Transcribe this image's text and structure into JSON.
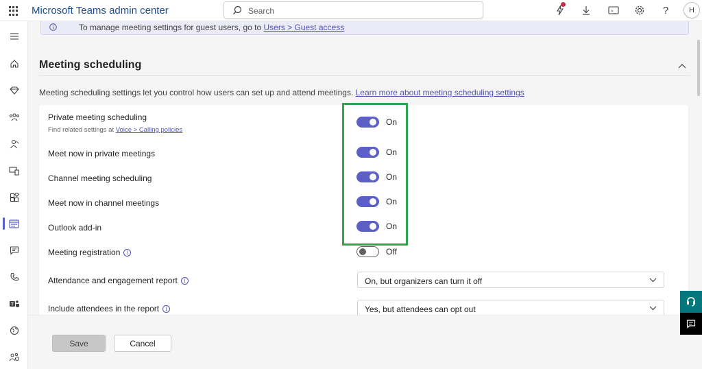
{
  "app": {
    "title": "Microsoft Teams admin center"
  },
  "search": {
    "placeholder": "Search"
  },
  "user": {
    "initial": "H"
  },
  "banner": {
    "text": "To manage meeting settings for guest users, go to ",
    "link": "Users > Guest access"
  },
  "section": {
    "title": "Meeting scheduling",
    "description": "Meeting scheduling settings let you control how users can set up and attend meetings. ",
    "learn_more": "Learn more about meeting scheduling settings"
  },
  "settings": [
    {
      "label": "Private meeting scheduling",
      "sub_prefix": "Find related settings at ",
      "sub_link": "Voice > Calling policies",
      "state": "On",
      "on": true
    },
    {
      "label": "Meet now in private meetings",
      "state": "On",
      "on": true
    },
    {
      "label": "Channel meeting scheduling",
      "state": "On",
      "on": true
    },
    {
      "label": "Meet now in channel meetings",
      "state": "On",
      "on": true
    },
    {
      "label": "Outlook add-in",
      "state": "On",
      "on": true
    },
    {
      "label": "Meeting registration",
      "state": "Off",
      "on": false
    }
  ],
  "dropdowns": [
    {
      "label": "Attendance and engagement report",
      "value": "On, but organizers can turn it off"
    },
    {
      "label": "Include attendees in the report",
      "value": "Yes, but attendees can opt out"
    }
  ],
  "footer": {
    "save": "Save",
    "cancel": "Cancel"
  },
  "icons": {
    "rail": [
      "menu-icon",
      "home-icon",
      "diamond-icon",
      "teams-icon",
      "users-icon",
      "devices-icon",
      "apps-icon",
      "meetings-icon",
      "messaging-icon",
      "voice-icon",
      "teams-logo-icon",
      "locations-icon",
      "people-settings-icon"
    ]
  },
  "colors": {
    "accent": "#5b5fc7",
    "highlight": "#2da44e",
    "link": "#4f52b2"
  }
}
